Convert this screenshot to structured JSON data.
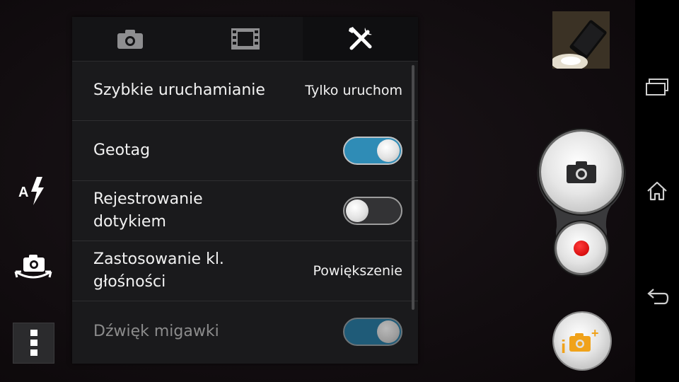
{
  "tabs": [
    {
      "name": "camera-tab",
      "icon": "camera-icon",
      "active": false
    },
    {
      "name": "video-tab",
      "icon": "film-icon",
      "active": false
    },
    {
      "name": "tools-tab",
      "icon": "tools-icon",
      "active": true
    }
  ],
  "settings": [
    {
      "label": "Szybkie uruchamianie",
      "value": "Tylko uruchom"
    },
    {
      "label": "Geotag",
      "toggle": "on"
    },
    {
      "label": "Rejestrowanie\ndotykiem",
      "toggle": "off"
    },
    {
      "label": "Zastosowanie kl.\ngłośności",
      "value": "Powiększenie"
    },
    {
      "label": "Dźwięk migawki",
      "toggle": "on",
      "disabled": true
    }
  ],
  "left_tools": [
    "auto-flash-icon",
    "switch-camera-icon",
    "menu-dots-icon"
  ],
  "right_controls": [
    "gallery-thumbnail",
    "shutter-button",
    "record-button",
    "superior-auto-button"
  ],
  "nav": [
    "recent-apps-icon",
    "home-icon",
    "back-icon"
  ],
  "colors": {
    "toggle_on": "#2f8cb6",
    "record": "#d80e0e",
    "ia_accent": "#f0a21a"
  }
}
